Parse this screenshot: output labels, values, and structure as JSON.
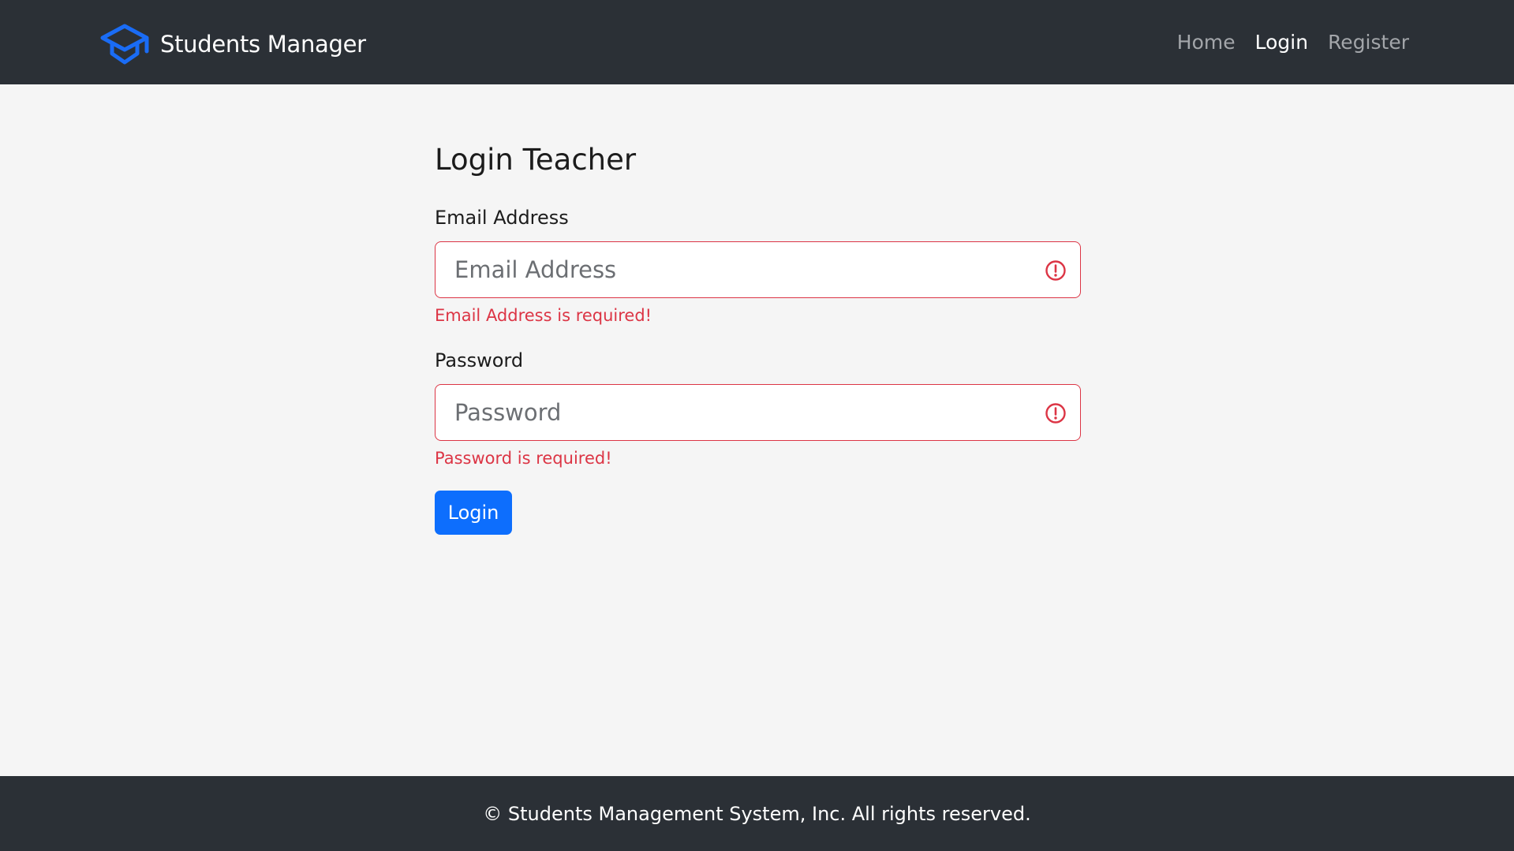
{
  "navbar": {
    "brand_title": "Students Manager",
    "brand_icon": "graduation-cap-icon",
    "links": [
      {
        "label": "Home",
        "active": false
      },
      {
        "label": "Login",
        "active": true
      },
      {
        "label": "Register",
        "active": false
      }
    ]
  },
  "form": {
    "title": "Login Teacher",
    "email": {
      "label": "Email Address",
      "placeholder": "Email Address",
      "value": "",
      "error": "Email Address is required!",
      "icon": "exclamation-circle-icon"
    },
    "password": {
      "label": "Password",
      "placeholder": "Password",
      "value": "",
      "error": "Password is required!",
      "icon": "exclamation-circle-icon"
    },
    "submit_label": "Login"
  },
  "footer": {
    "text": "© Students Management System, Inc. All rights reserved."
  },
  "colors": {
    "navbar_bg": "#2b3036",
    "page_bg": "#f5f5f5",
    "brand_icon": "#0d6efd",
    "danger": "#dc3545",
    "primary": "#0d6efd"
  }
}
